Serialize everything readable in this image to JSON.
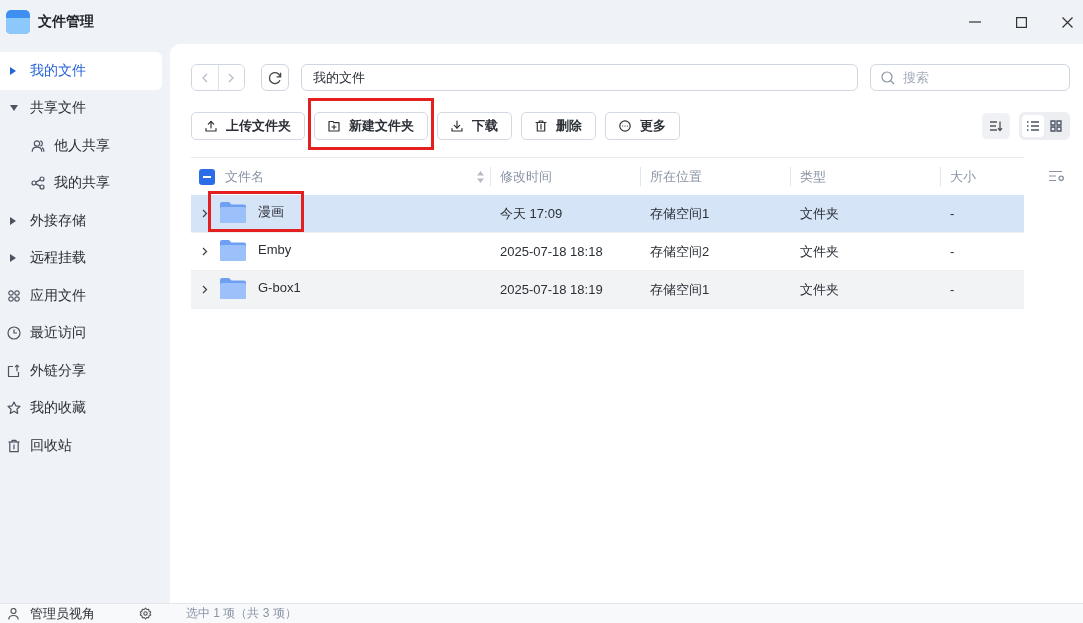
{
  "window": {
    "title": "文件管理"
  },
  "sidebar": {
    "items": [
      {
        "label": "我的文件",
        "kind": "tree",
        "expanded": false,
        "selected": true
      },
      {
        "label": "共享文件",
        "kind": "tree",
        "expanded": true,
        "selected": false,
        "children": [
          {
            "label": "他人共享",
            "kind": "people",
            "selected": false
          },
          {
            "label": "我的共享",
            "kind": "share",
            "selected": false
          }
        ]
      },
      {
        "label": "外接存储",
        "kind": "tree",
        "expanded": false,
        "selected": false
      },
      {
        "label": "远程挂载",
        "kind": "tree",
        "expanded": false,
        "selected": false
      },
      {
        "label": "应用文件",
        "kind": "apps",
        "selected": false
      },
      {
        "label": "最近访问",
        "kind": "clock",
        "selected": false
      },
      {
        "label": "外链分享",
        "kind": "external",
        "selected": false
      },
      {
        "label": "我的收藏",
        "kind": "star",
        "selected": false
      },
      {
        "label": "回收站",
        "kind": "trash",
        "selected": false
      }
    ]
  },
  "nav": {
    "back": {
      "disabled": true
    },
    "forward": {
      "disabled": true
    },
    "path": "我的文件"
  },
  "search": {
    "placeholder": "搜索"
  },
  "toolbar": {
    "buttons": [
      {
        "label": "上传文件夹",
        "kind": "upload",
        "highlighted": false
      },
      {
        "label": "新建文件夹",
        "kind": "new_folder",
        "highlighted": true
      },
      {
        "label": "下载",
        "kind": "download",
        "highlighted": false
      },
      {
        "label": "删除",
        "kind": "delete",
        "highlighted": false
      },
      {
        "label": "更多",
        "kind": "more",
        "highlighted": false
      }
    ],
    "view_modes": [
      {
        "kind": "list",
        "selected": true
      },
      {
        "kind": "grid",
        "selected": false
      }
    ]
  },
  "table": {
    "select_all": {
      "indeterminate": true
    },
    "columns": [
      {
        "label": "文件名",
        "sortable": true
      },
      {
        "label": "修改时间",
        "sortable": false
      },
      {
        "label": "所在位置",
        "sortable": false
      },
      {
        "label": "类型",
        "sortable": false
      },
      {
        "label": "大小",
        "sortable": false
      }
    ],
    "rows": [
      {
        "name": "漫画",
        "modified": "今天 17:09",
        "location": "存储空间1",
        "type": "文件夹",
        "size": "-",
        "expanded": false,
        "selected": true,
        "hovered": false,
        "highlighted": true
      },
      {
        "name": "Emby",
        "modified": "2025-07-18 18:18",
        "location": "存储空间2",
        "type": "文件夹",
        "size": "-",
        "expanded": false,
        "selected": false,
        "hovered": false,
        "highlighted": false
      },
      {
        "name": "G-box1",
        "modified": "2025-07-18 18:19",
        "location": "存储空间1",
        "type": "文件夹",
        "size": "-",
        "expanded": false,
        "selected": false,
        "hovered": true,
        "highlighted": false
      }
    ]
  },
  "status_bar": {
    "user": "管理员视角",
    "selection": "选中 1 项（共 3 项）"
  }
}
